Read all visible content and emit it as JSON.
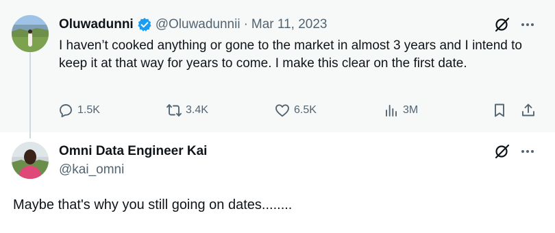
{
  "parent_tweet": {
    "author_name": "Oluwadunni",
    "handle": "@Oluwadunnii",
    "separator": "·",
    "date": "Mar 11, 2023",
    "verified": true,
    "text": "I haven’t cooked anything or gone to the market in almost 3 years and I intend to keep it at that way for years to come. I make this clear on the first date.",
    "actions": {
      "replies": "1.5K",
      "reposts": "3.4K",
      "likes": "6.5K",
      "views": "3M"
    }
  },
  "reply_tweet": {
    "author_name": "Omni Data Engineer Kai",
    "handle": "@kai_omni",
    "text": "Maybe that's why you still going on dates........"
  },
  "icons": {
    "reply": "reply-icon",
    "repost": "repost-icon",
    "like": "heart-icon",
    "views": "views-icon",
    "bookmark": "bookmark-icon",
    "share": "share-icon",
    "grok": "grok-icon",
    "more": "more-icon",
    "verified": "verified-badge-icon"
  },
  "colors": {
    "text": "#0f1419",
    "secondary": "#536471",
    "verified": "#1d9bf0",
    "parent_background": "#f7f9f9",
    "thread_line": "#cfd9de"
  }
}
